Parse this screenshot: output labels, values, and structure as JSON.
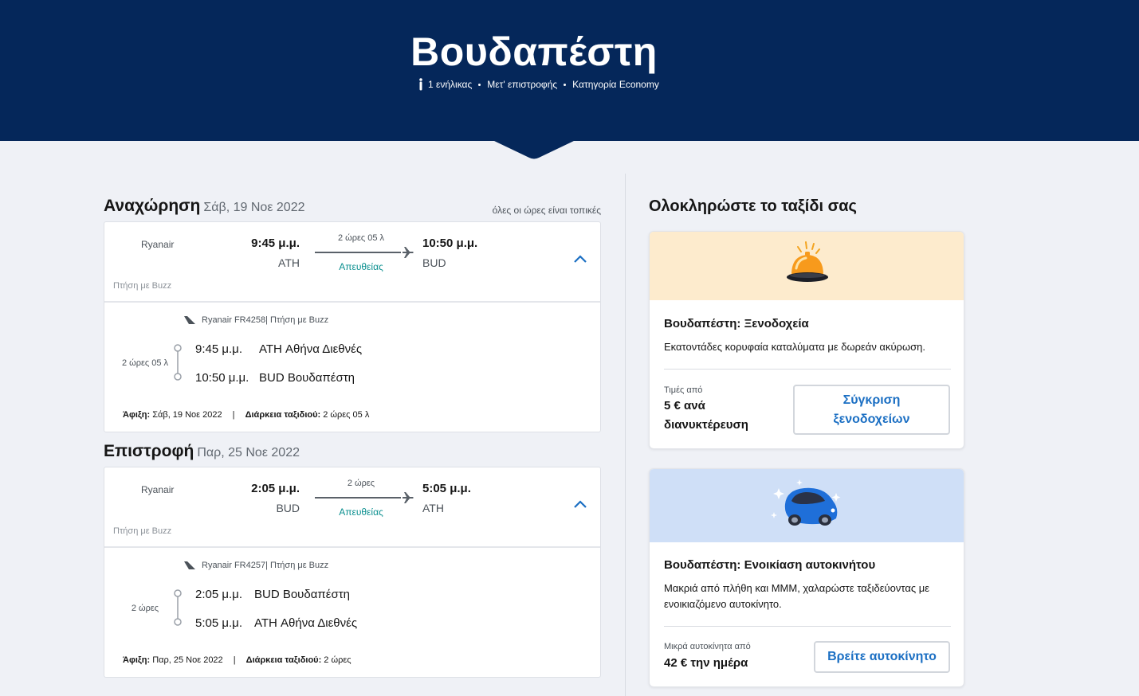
{
  "header": {
    "title": "Βουδαπέστη",
    "passengers": "1 ενήλικας",
    "trip_type": "Μετ' επιστροφής",
    "cabin": "Κατηγορία Economy"
  },
  "outbound": {
    "title": "Αναχώρηση",
    "date": "Σάβ, 19 Νοε 2022",
    "tz_note": "όλες οι ώρες είναι τοπικές",
    "airline": "Ryanair",
    "operated_by": "Πτήση με Buzz",
    "dep_time": "9:45 μ.μ.",
    "dep_code": "ATH",
    "arr_time": "10:50 μ.μ.",
    "arr_code": "BUD",
    "duration": "2 ώρες 05 λ",
    "stops": "Απευθείας",
    "leg_airline": "Ryanair FR4258| Πτήση με Buzz",
    "leg_duration": "2 ώρες 05 λ",
    "leg_dep_time": "9:45 μ.μ.",
    "leg_dep_airport": "ATH Αθήνα Διεθνές",
    "leg_arr_time": "10:50 μ.μ.",
    "leg_arr_airport": "BUD Βουδαπέστη",
    "arrival_label": "Άφιξη:",
    "arrival_value": " Σάβ, 19 Νοε 2022",
    "trip_dur_label": "Διάρκεια ταξιδιού:",
    "trip_dur_value": " 2 ώρες 05 λ"
  },
  "return": {
    "title": "Επιστροφή",
    "date": "Παρ, 25 Νοε 2022",
    "airline": "Ryanair",
    "operated_by": "Πτήση με Buzz",
    "dep_time": "2:05 μ.μ.",
    "dep_code": "BUD",
    "arr_time": "5:05 μ.μ.",
    "arr_code": "ATH",
    "duration": "2 ώρες",
    "stops": "Απευθείας",
    "leg_airline": "Ryanair FR4257| Πτήση με Buzz",
    "leg_duration": "2 ώρες",
    "leg_dep_time": "2:05 μ.μ.",
    "leg_dep_airport": "BUD Βουδαπέστη",
    "leg_arr_time": "5:05 μ.μ.",
    "leg_arr_airport": "ATH Αθήνα Διεθνές",
    "arrival_label": "Άφιξη:",
    "arrival_value": " Παρ, 25 Νοε 2022",
    "trip_dur_label": "Διάρκεια ταξιδιού:",
    "trip_dur_value": " 2 ώρες"
  },
  "sidebar": {
    "title": "Ολοκληρώστε το ταξίδι σας",
    "hotels": {
      "title": "Βουδαπέστη: Ξενοδοχεία",
      "desc": "Εκατοντάδες κορυφαία καταλύματα με δωρεάν ακύρωση.",
      "price_label": "Τιμές από",
      "price_value_1": "5 € ανά",
      "price_value_2": "διανυκτέρευση",
      "button_1": "Σύγκριση",
      "button_2": "ξενοδοχείων",
      "banner_color": "#fdebcd"
    },
    "cars": {
      "title": "Βουδαπέστη: Ενοικίαση αυτοκινήτου",
      "desc": "Μακριά από πλήθη και ΜΜΜ, χαλαρώστε ταξιδεύοντας με ενοικιαζόμενο αυτοκίνητο.",
      "price_label": "Μικρά αυτοκίνητα από",
      "price_value": "42 € την ημέρα",
      "button": "Βρείτε αυτοκίνητο",
      "banner_color": "#cfdff7"
    }
  },
  "colors": {
    "header_bg": "#05275a",
    "accent_teal": "#0a8f8f",
    "link_blue": "#1b6fc3"
  }
}
